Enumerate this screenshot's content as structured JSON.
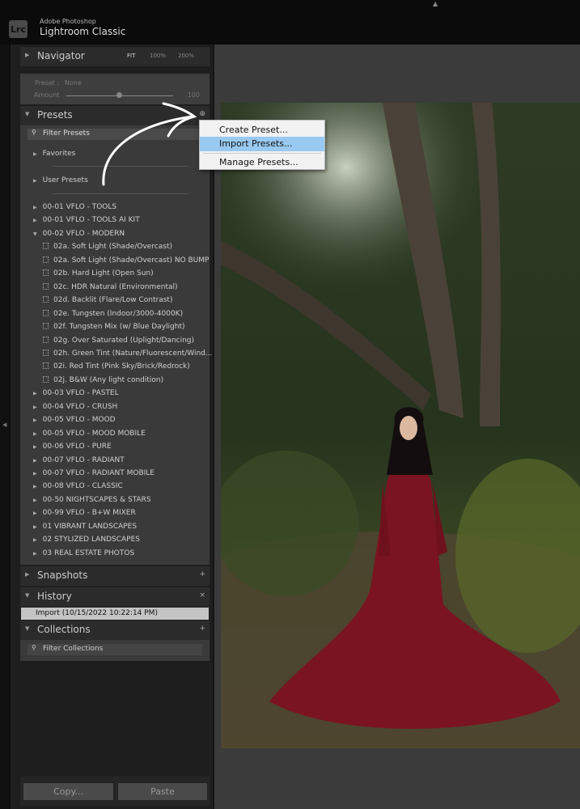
{
  "app": {
    "brand_line1": "Adobe Photoshop",
    "brand_line2": "Lightroom Classic",
    "logo": "Lrc"
  },
  "navigator": {
    "title": "Navigator",
    "zoom_options": [
      "FIT",
      "100%",
      "200%"
    ]
  },
  "preset_info": {
    "preset_label": "Preset :",
    "preset_value": "None",
    "amount_label": "Amount",
    "amount_value": "100",
    "amount_fraction": 0.5
  },
  "presets": {
    "title": "Presets",
    "filter_placeholder": "Filter Presets",
    "favorites": "Favorites",
    "user_presets": "User Presets",
    "groups_before": [
      "00-01 VFLO - TOOLS",
      "00-01 VFLO - TOOLS AI KIT"
    ],
    "expanded_group": "00-02 VFLO - MODERN",
    "expanded_items": [
      "02a. Soft Light (Shade/Overcast)",
      "02a. Soft Light (Shade/Overcast) NO BUMP",
      "02b. Hard Light (Open Sun)",
      "02c. HDR Natural (Environmental)",
      "02d. Backlit (Flare/Low Contrast)",
      "02e. Tungsten (Indoor/3000-4000K)",
      "02f. Tungsten Mix (w/ Blue Daylight)",
      "02g. Over Saturated (Uplight/Dancing)",
      "02h. Green Tint (Nature/Fluorescent/Wind...",
      "02i. Red Tint (Pink Sky/Brick/Redrock)",
      "02j. B&W (Any light condition)"
    ],
    "groups_after": [
      "00-03 VFLO - PASTEL",
      "00-04 VFLO - CRUSH",
      "00-05 VFLO - MOOD",
      "00-05 VFLO - MOOD MOBILE",
      "00-06 VFLO - PURE",
      "00-07 VFLO - RADIANT",
      "00-07 VFLO - RADIANT MOBILE",
      "00-08 VFLO - CLASSIC",
      "00-50 NIGHTSCAPES & STARS",
      "00-99 VFLO - B+W MIXER",
      "01 VIBRANT LANDSCAPES",
      "02 STYLIZED LANDSCAPES",
      "03 REAL ESTATE PHOTOS"
    ]
  },
  "snapshots": {
    "title": "Snapshots"
  },
  "history": {
    "title": "History",
    "items": [
      "Import (10/15/2022 10:22:14 PM)"
    ]
  },
  "collections": {
    "title": "Collections",
    "filter_placeholder": "Filter Collections"
  },
  "buttons": {
    "copy": "Copy...",
    "paste": "Paste"
  },
  "context_menu": {
    "items": [
      "Create Preset...",
      "Import Presets...",
      "Manage Presets..."
    ],
    "highlighted": "Import Presets...",
    "highlight_color": "#99c9f0"
  }
}
